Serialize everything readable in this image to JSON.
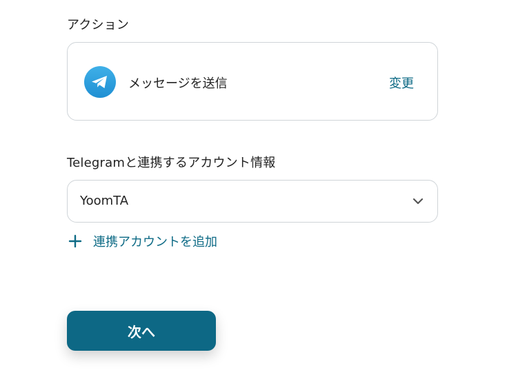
{
  "action_section": {
    "label": "アクション",
    "action_name": "メッセージを送信",
    "change_label": "変更",
    "icon": "telegram-icon"
  },
  "account_section": {
    "label": "Telegramと連携するアカウント情報",
    "selected_account": "YoomTA",
    "add_account_label": "連携アカウントを追加"
  },
  "footer": {
    "next_label": "次へ"
  },
  "colors": {
    "accent": "#0d6a85",
    "button_bg": "#0d6885",
    "telegram_blue": "#2aa3e0",
    "border": "#cfd4d8"
  }
}
